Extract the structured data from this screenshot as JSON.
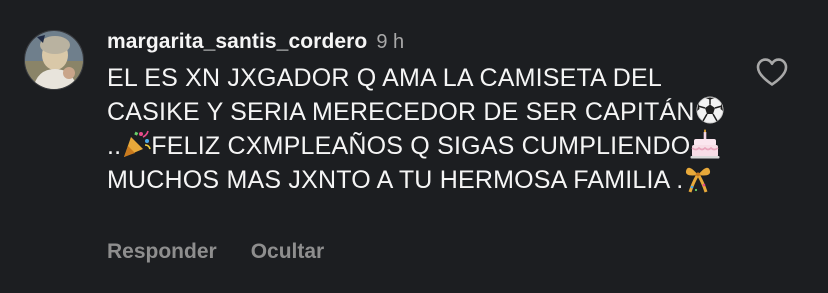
{
  "comment": {
    "username": "margarita_santis_cordero",
    "timestamp": "9 h",
    "text_parts": [
      "EL ES XN JXGADOR Q AMA LA CAMISETA DEL CASIKE Y SERIA MERECEDOR DE SER CAPITÁN",
      " ..",
      "FELIZ CXMPLEAÑOS Q SIGAS CUMPLIENDO",
      " MUCHOS MAS JXNTO A TU HERMOSA FAMILIA .",
      ""
    ],
    "emojis": [
      "soccer-ball-icon",
      "party-popper-icon",
      "birthday-cake-icon",
      "ribbon-icon"
    ],
    "like_icon": "heart-outline-icon"
  },
  "actions": {
    "reply": "Responder",
    "hide": "Ocultar"
  }
}
